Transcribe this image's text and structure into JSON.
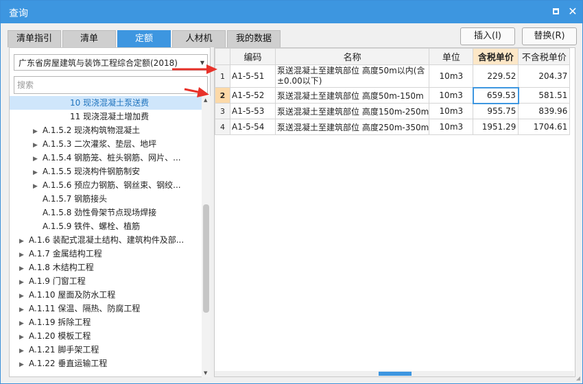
{
  "window": {
    "title": "查询",
    "restore": "□",
    "close": "✕"
  },
  "tabs": [
    "清单指引",
    "清单",
    "定额",
    "人材机",
    "我的数据"
  ],
  "buttons": {
    "insert": "插入(I)",
    "replace": "替换(R)"
  },
  "left": {
    "library": "广东省房屋建筑与装饰工程综合定额(2018)",
    "search_placeholder": "搜索",
    "tree": [
      {
        "label": "10 现浇混凝土泵送费",
        "level": 3,
        "expander": false,
        "selected": true
      },
      {
        "label": "11 现浇混凝土增加费",
        "level": 3,
        "expander": false,
        "selected": false
      },
      {
        "label": "A.1.5.2 现浇构筑物混凝土",
        "level": 2,
        "expander": true,
        "selected": false
      },
      {
        "label": "A.1.5.3 二次灌浆、垫层、地坪",
        "level": 2,
        "expander": true,
        "selected": false
      },
      {
        "label": "A.1.5.4 钢筋笼、桩头钢筋、网片、...",
        "level": 2,
        "expander": true,
        "selected": false
      },
      {
        "label": "A.1.5.5 现浇构件钢筋制安",
        "level": 2,
        "expander": true,
        "selected": false
      },
      {
        "label": "A.1.5.6 预应力钢筋、钢丝束、钢绞...",
        "level": 2,
        "expander": true,
        "selected": false
      },
      {
        "label": "A.1.5.7 钢筋接头",
        "level": 2,
        "expander": false,
        "selected": false
      },
      {
        "label": "A.1.5.8 劲性骨架节点现场焊接",
        "level": 2,
        "expander": false,
        "selected": false
      },
      {
        "label": "A.1.5.9 铁件、螺栓、植筋",
        "level": 2,
        "expander": false,
        "selected": false
      },
      {
        "label": "A.1.6 装配式混凝土结构、建筑构件及部...",
        "level": 1,
        "expander": true,
        "selected": false
      },
      {
        "label": "A.1.7 金属结构工程",
        "level": 1,
        "expander": true,
        "selected": false
      },
      {
        "label": "A.1.8 木结构工程",
        "level": 1,
        "expander": true,
        "selected": false
      },
      {
        "label": "A.1.9 门窗工程",
        "level": 1,
        "expander": true,
        "selected": false
      },
      {
        "label": "A.1.10 屋面及防水工程",
        "level": 1,
        "expander": true,
        "selected": false
      },
      {
        "label": "A.1.11 保温、隔热、防腐工程",
        "level": 1,
        "expander": true,
        "selected": false
      },
      {
        "label": "A.1.19 拆除工程",
        "level": 1,
        "expander": true,
        "selected": false
      },
      {
        "label": "A.1.20 模板工程",
        "level": 1,
        "expander": true,
        "selected": false
      },
      {
        "label": "A.1.21 脚手架工程",
        "level": 1,
        "expander": true,
        "selected": false
      },
      {
        "label": "A.1.22 垂直运输工程",
        "level": 1,
        "expander": true,
        "selected": false
      }
    ]
  },
  "grid": {
    "headers": [
      "编码",
      "名称",
      "单位",
      "含税单价",
      "不含税单价"
    ],
    "rows": [
      {
        "n": "1",
        "code": "A1-5-51",
        "name": "泵送混凝土至建筑部位 高度50m以内(含±0.00以下)",
        "unit": "10m3",
        "tax": "229.52",
        "notax": "204.37"
      },
      {
        "n": "2",
        "code": "A1-5-52",
        "name": "泵送混凝土至建筑部位 高度50m-150m",
        "unit": "10m3",
        "tax": "659.53",
        "notax": "581.51"
      },
      {
        "n": "3",
        "code": "A1-5-53",
        "name": "泵送混凝土至建筑部位 高度150m-250m",
        "unit": "10m3",
        "tax": "955.75",
        "notax": "839.96"
      },
      {
        "n": "4",
        "code": "A1-5-54",
        "name": "泵送混凝土至建筑部位 高度250m-350m",
        "unit": "10m3",
        "tax": "1951.29",
        "notax": "1704.61"
      }
    ]
  },
  "colors": {
    "accent": "#3d96e0",
    "annotation": "#e8322a",
    "highlight_header": "#fde7c7"
  }
}
